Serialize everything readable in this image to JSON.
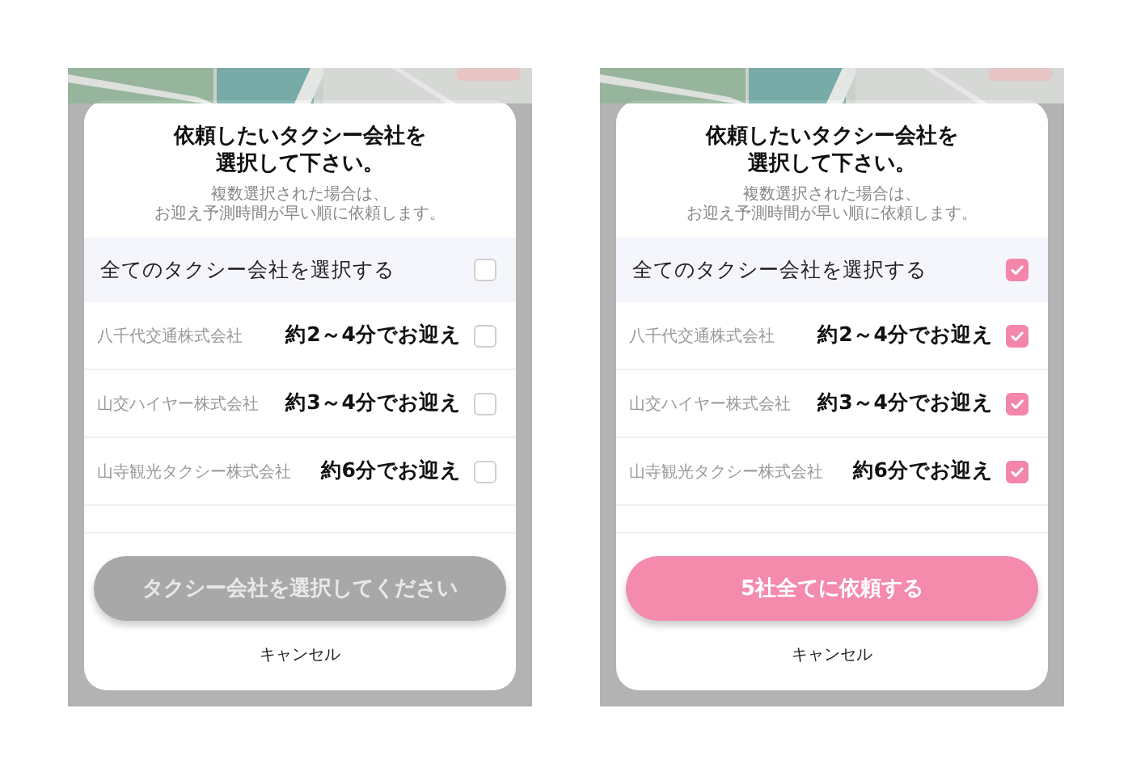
{
  "screens": [
    {
      "title_lines": [
        "依頼したいタクシー会社を",
        "選択して下さい。"
      ],
      "subtitle_lines": [
        "複数選択された場合は、",
        "お迎え予測時間が早い順に依頼します。"
      ],
      "select_all": {
        "label": "全てのタクシー会社を選択する",
        "checked": false
      },
      "companies": [
        {
          "name": "八千代交通株式会社",
          "eta": "約2～4分でお迎え",
          "checked": false
        },
        {
          "name": "山交ハイヤー株式会社",
          "eta": "約3～4分でお迎え",
          "checked": false
        },
        {
          "name": "山寺観光タクシー株式会社",
          "eta": "約6分でお迎え",
          "checked": false
        }
      ],
      "primary_button": {
        "label": "タクシー会社を選択してください",
        "enabled": false
      },
      "cancel": "キャンセル"
    },
    {
      "title_lines": [
        "依頼したいタクシー会社を",
        "選択して下さい。"
      ],
      "subtitle_lines": [
        "複数選択された場合は、",
        "お迎え予測時間が早い順に依頼します。"
      ],
      "select_all": {
        "label": "全てのタクシー会社を選択する",
        "checked": true
      },
      "companies": [
        {
          "name": "八千代交通株式会社",
          "eta": "約2～4分でお迎え",
          "checked": true
        },
        {
          "name": "山交ハイヤー株式会社",
          "eta": "約3～4分でお迎え",
          "checked": true
        },
        {
          "name": "山寺観光タクシー株式会社",
          "eta": "約6分でお迎え",
          "checked": true
        }
      ],
      "primary_button": {
        "label": "5社全てに依頼する",
        "enabled": true
      },
      "cancel": "キャンセル"
    }
  ]
}
